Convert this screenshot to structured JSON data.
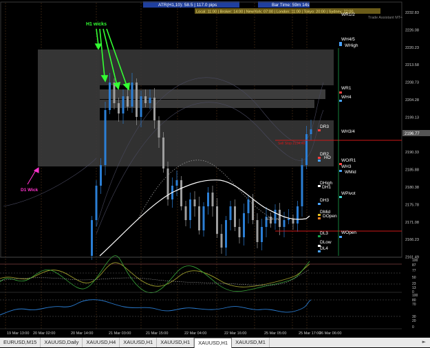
{
  "header": {
    "atr_value": "ATR(H1,10): 58.5 | 117.0 pips",
    "bar_time": "Bar Time: 59m 14s",
    "sessions": "Local: 11:00 | Broker: 14:00 | NewYork: 07:00 | London: 11:00 | Tokyo: 20:00 | Sydney: 22:00",
    "indicator_name": "Trade Assistant MT4"
  },
  "annotations": {
    "h1_wicks": "H1 wicks",
    "d1_wick": "D1 Wick"
  },
  "current_price": "2196.77",
  "price_axis": [
    "2232.83",
    "2226.08",
    "2220.23",
    "2213.58",
    "2208.73",
    "2204.28",
    "2199.13",
    "2194.78",
    "2190.33",
    "2185.88",
    "2180.38",
    "2175.78",
    "2171.08",
    "2166.23",
    "2161.49"
  ],
  "levels_right": [
    "WR1/2",
    "WH4/5",
    "WHigh",
    "WR1",
    "WH4",
    "WH3/4",
    "WO/R1",
    "WH3",
    "WMid",
    "WPivot",
    "WOpen"
  ],
  "levels_mid": [
    "DR3",
    "DR2",
    "HO",
    "DHigh",
    "DH1",
    "DH3",
    "DMid",
    "DOpen",
    "DL3",
    "DLow",
    "DL4"
  ],
  "inline_labels": [
    "Sell Stop 2194.48",
    "ADR Low"
  ],
  "time_axis": [
    "19 Mar 13:00",
    "20 Mar 02:00",
    "20 Mar 14:00",
    "21 Mar 03:00",
    "21 Mar 15:00",
    "22 Mar 04:00",
    "22 Mar 16:00",
    "25 Mar 05:00",
    "25 Mar 17:00",
    "26 Mar 06:00"
  ],
  "osc1_axis": [
    "100",
    "87",
    "77",
    "50",
    "23",
    "13",
    "0"
  ],
  "osc2_axis": [
    "100",
    "80",
    "70",
    "30",
    "20",
    "0"
  ],
  "tabs": [
    "EURUSD,M15",
    "XAUUSD,Daily",
    "XAUUSD,H4",
    "XAUUSD,H1",
    "XAUUSD,H1",
    "XAUUSD,H1",
    "XAUUSD,M1"
  ],
  "active_tab": 5,
  "colors": {
    "bull": "#2b7fd6",
    "bear": "#9e9e9e",
    "ma": "#ffffff",
    "annotation": "#33ff33",
    "d1": "#ff33cc",
    "level_red": "#d01818",
    "level_green": "#1aa34a"
  }
}
